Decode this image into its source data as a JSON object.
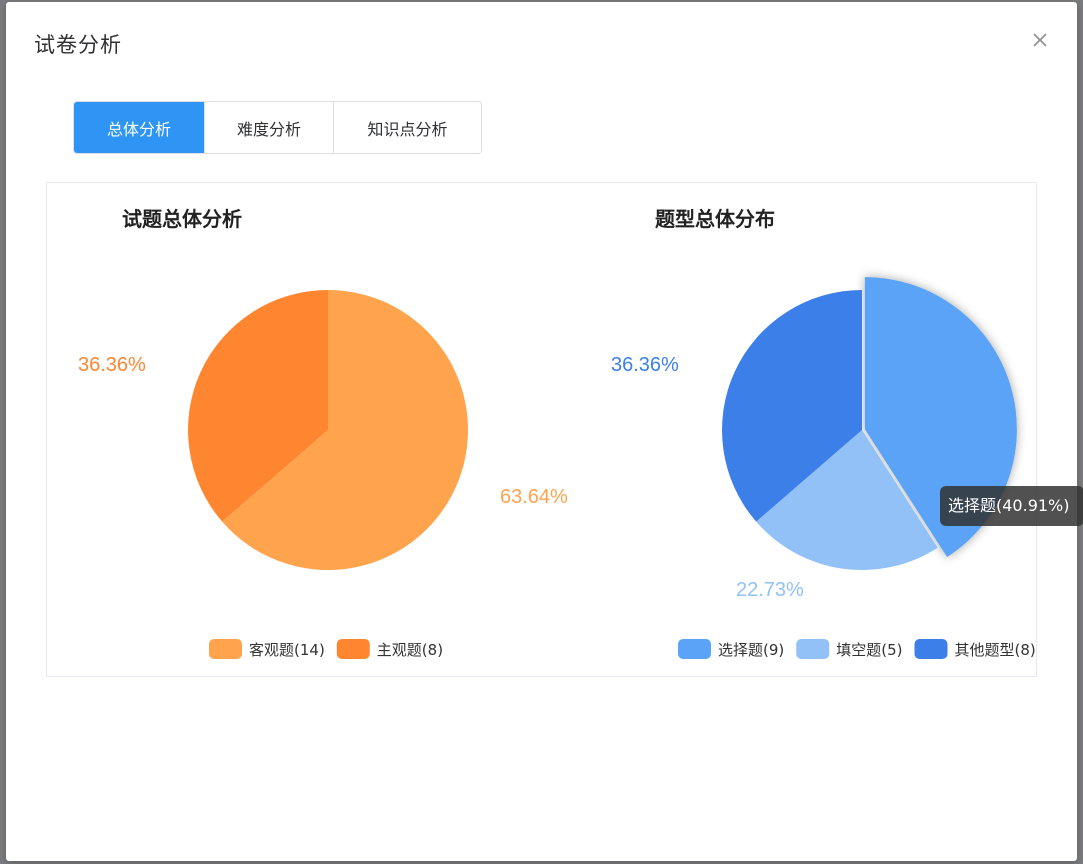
{
  "dialog": {
    "title": "试卷分析",
    "close_icon": "close-icon"
  },
  "tabs": [
    {
      "label": "总体分析",
      "active": true
    },
    {
      "label": "难度分析",
      "active": false
    },
    {
      "label": "知识点分析",
      "active": false
    }
  ],
  "colors": {
    "accent": "#2f95f5",
    "orange_light": "#ffa34d",
    "orange_dark": "#ff8631",
    "blue_main": "#5aa3f7",
    "blue_light": "#92c1f8",
    "blue_dark": "#3d7fe9"
  },
  "chart_data": [
    {
      "type": "pie",
      "title": "试题总体分析",
      "slices": [
        {
          "name": "客观题(14)",
          "value": 14,
          "percent": "63.64%",
          "color": "#ffa34d"
        },
        {
          "name": "主观题(8)",
          "value": 8,
          "percent": "36.36%",
          "color": "#ff8631"
        }
      ],
      "legend_position": "bottom"
    },
    {
      "type": "pie",
      "title": "题型总体分布",
      "slices": [
        {
          "name": "选择题(9)",
          "value": 9,
          "percent": "",
          "color": "#5aa3f7",
          "highlighted": true
        },
        {
          "name": "填空题(5)",
          "value": 5,
          "percent": "22.73%",
          "color": "#92c1f8"
        },
        {
          "name": "其他题型(8)",
          "value": 8,
          "percent": "36.36%",
          "color": "#3d7fe9"
        }
      ],
      "legend_position": "bottom",
      "tooltip": "选择题(40.91%)"
    }
  ]
}
